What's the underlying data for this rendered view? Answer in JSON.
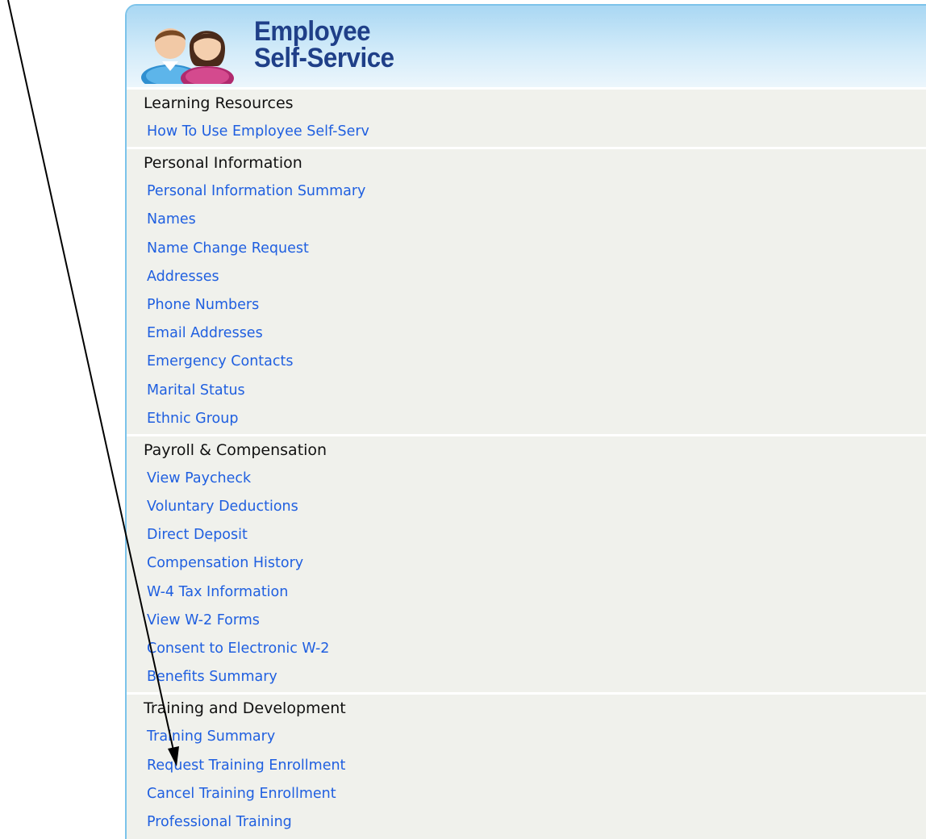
{
  "header": {
    "title_line1": "Employee",
    "title_line2": "Self-Service",
    "icon": "employees-icon"
  },
  "sections": [
    {
      "title": "Learning Resources",
      "links": [
        "How To Use Employee Self-Serv"
      ]
    },
    {
      "title": "Personal Information",
      "links": [
        "Personal Information Summary",
        "Names",
        "Name Change Request",
        "Addresses",
        "Phone Numbers",
        "Email Addresses",
        "Emergency Contacts",
        "Marital Status",
        "Ethnic Group"
      ]
    },
    {
      "title": "Payroll & Compensation",
      "links": [
        "View Paycheck",
        "Voluntary Deductions",
        "Direct Deposit",
        "Compensation History",
        "W-4 Tax Information",
        "View W-2 Forms",
        "Consent to Electronic W-2",
        "Benefits Summary"
      ]
    },
    {
      "title": "Training and Development",
      "links": [
        "Training Summary",
        "Request Training Enrollment",
        "Cancel Training Enrollment",
        "Professional Training"
      ]
    }
  ],
  "colors": {
    "link": "#1f5fe0",
    "header_title": "#1f3f88",
    "panel_border": "#7cc3ea",
    "panel_bg": "#f0f1ec"
  },
  "annotation": {
    "icon": "pointer-arrow-icon"
  }
}
